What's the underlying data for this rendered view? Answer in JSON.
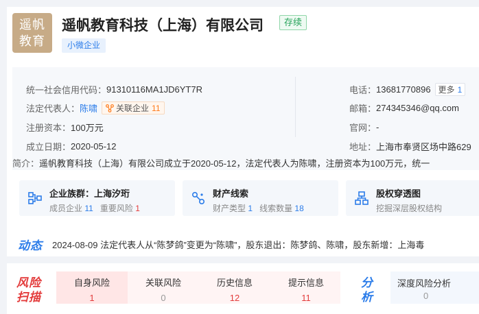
{
  "company": {
    "logo_line1": "遥帆",
    "logo_line2": "教育",
    "name": "遥帆教育科技（上海）有限公司",
    "status": "存续",
    "scale_tag": "小微企业"
  },
  "info": {
    "credit_code_label": "统一社会信用代码：",
    "credit_code": "91310116MA1JD6YT7R",
    "legal_rep_label": "法定代表人：",
    "legal_rep": "陈啸",
    "assoc_label": "关联企业",
    "assoc_count": "11",
    "capital_label": "注册资本：",
    "capital": "100万元",
    "founded_label": "成立日期：",
    "founded": "2020-05-12",
    "phone_label": "电话：",
    "phone": "13681770896",
    "more_label": "更多",
    "more_count": "1",
    "email_label": "邮箱：",
    "email": "274345346@qq.com",
    "website_label": "官网：",
    "website": "-",
    "address_label": "地址：",
    "address": "上海市奉贤区场中路629",
    "brief_label": "简介：",
    "brief": "遥帆教育科技（上海）有限公司成立于2020-05-12，法定代表人为陈啸，注册资本为100万元，统一"
  },
  "features": [
    {
      "title": "企业族群：上海汐珩",
      "sub1_label": "成员企业",
      "sub1_value": "11",
      "sub2_label": "重要风险",
      "sub2_value": "1",
      "icon": "org-chart-icon"
    },
    {
      "title": "财产线索",
      "sub1_label": "财产类型",
      "sub1_value": "1",
      "sub2_label": "线索数量",
      "sub2_value": "18",
      "icon": "link-nodes-icon"
    },
    {
      "title": "股权穿透图",
      "sub_text": "挖掘深层股权结构",
      "icon": "equity-tree-icon"
    }
  ],
  "dynamics": {
    "label": "动态",
    "text": "2024-08-09 法定代表人从“陈梦鸽”变更为“陈啸”，股东退出：陈梦鸽、陈啸，股东新增：上海毒"
  },
  "risk": {
    "label_line1": "风险",
    "label_line2": "扫描",
    "items": [
      {
        "label": "自身风险",
        "value": "1"
      },
      {
        "label": "关联风险",
        "value": "0"
      },
      {
        "label": "历史信息",
        "value": "12"
      },
      {
        "label": "提示信息",
        "value": "11"
      }
    ]
  },
  "analysis": {
    "label_line1": "分",
    "label_line2": "析",
    "item_label": "深度风险分析",
    "item_value": "0"
  },
  "colors": {
    "accent_blue": "#2b7ce9",
    "risk_red": "#e33b3b",
    "status_green": "#27a35a",
    "logo_bg": "#c7ab87"
  }
}
